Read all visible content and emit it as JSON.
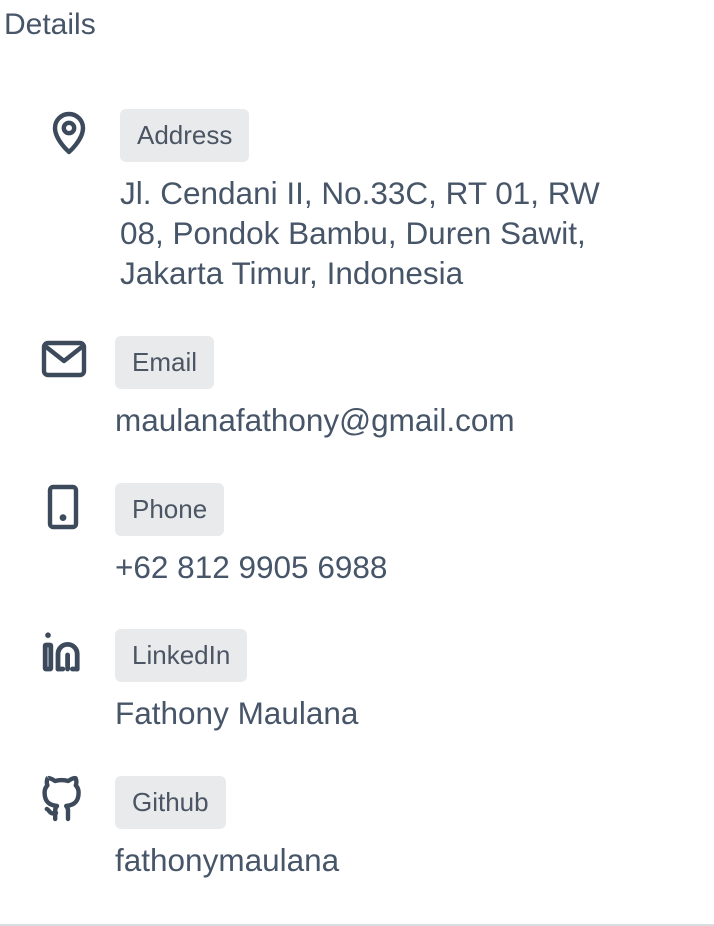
{
  "section": {
    "title": "Details"
  },
  "details": {
    "address": {
      "icon": "map-pin-icon",
      "label": "Address",
      "value": "Jl. Cendani II, No.33C, RT 01, RW 08, Pondok Bambu, Duren Sawit, Jakarta Timur, Indonesia"
    },
    "email": {
      "icon": "mail-icon",
      "label": "Email",
      "value": "maulanafathony@gmail.com"
    },
    "phone": {
      "icon": "phone-icon",
      "label": "Phone",
      "value": "+62 812 9905 6988"
    },
    "linkedin": {
      "icon": "linkedin-icon",
      "label": "LinkedIn",
      "value": "Fathony Maulana"
    },
    "github": {
      "icon": "github-icon",
      "label": "Github",
      "value": "fathonymaulana"
    }
  },
  "colors": {
    "text": "#475569",
    "icon": "#3d4a5c",
    "badge_bg": "#e9eaec"
  }
}
